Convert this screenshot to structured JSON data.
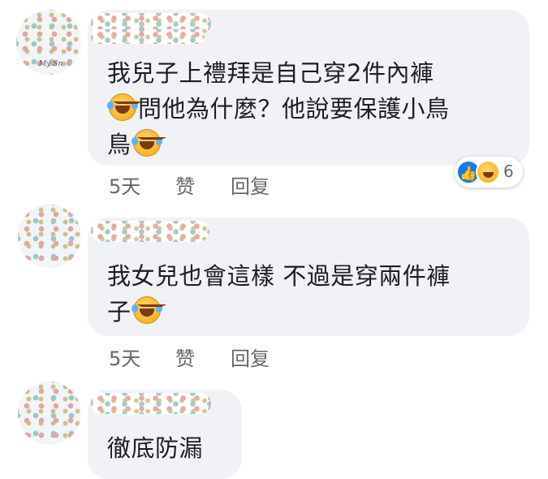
{
  "comments": [
    {
      "avatar_tag": "My Sn",
      "lines": [
        "我兒子上禮拜是自己穿2件內褲",
        "問他為什麼？他說要保護小鳥",
        "鳥"
      ],
      "time": "5天",
      "like": "赞",
      "reply": "回复",
      "reaction_count": "6"
    },
    {
      "lines": [
        "我女兒也會這樣 不過是穿兩件褲",
        "子"
      ],
      "time": "5天",
      "like": "赞",
      "reply": "回复"
    },
    {
      "lines": [
        "徹底防漏"
      ]
    }
  ],
  "icons": {
    "reaction_like": "like-icon",
    "reaction_haha": "haha-icon",
    "emoji": "laughing-tears-emoji"
  },
  "colors": {
    "bubble": "#f0f2f5",
    "text": "#1c1e21",
    "meta": "#65676b",
    "like_blue": "#1877f2"
  }
}
